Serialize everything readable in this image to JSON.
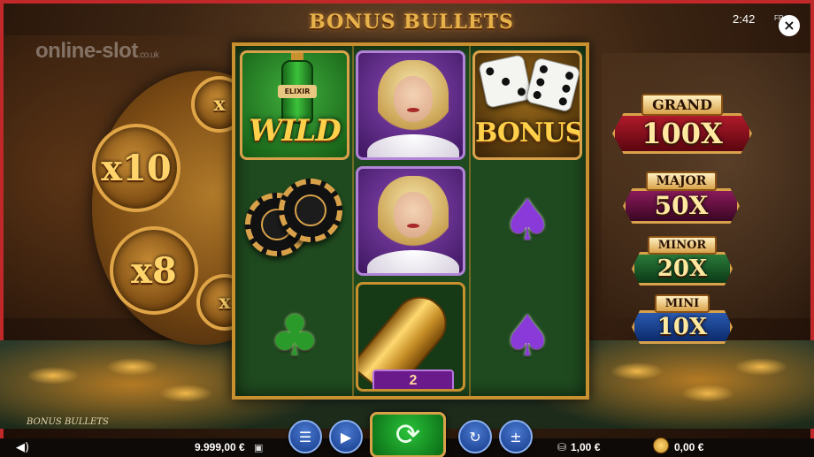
{
  "game": {
    "title": "BONUS BULLETS",
    "footer_name": "BONUS BULLETS"
  },
  "watermark": {
    "text": "online-slot",
    "suffix": ".co.uk"
  },
  "status": {
    "clock": "2:42",
    "fr_label": "FR"
  },
  "close_icon": "close-icon",
  "cylinder": {
    "multipliers": [
      "x10",
      "x8"
    ],
    "partial_labels": [
      "x",
      "x"
    ]
  },
  "reels": {
    "symbols": [
      [
        "wild-elixir",
        "blonde-lady",
        "bonus-dice"
      ],
      [
        "casino-chips",
        "blonde-lady",
        "spade"
      ],
      [
        "club",
        "golden-bullet",
        "spade"
      ]
    ],
    "wild_label": "WILD",
    "elixir_label": "ELIXIR",
    "bonus_label": "BONUS",
    "bullet_value": "2"
  },
  "jackpots": [
    {
      "name": "GRAND",
      "value": "100X"
    },
    {
      "name": "MAJOR",
      "value": "50X"
    },
    {
      "name": "MINOR",
      "value": "20X"
    },
    {
      "name": "MINI",
      "value": "10X"
    }
  ],
  "bottom_bar": {
    "balance": "9.999,00 €",
    "bet": "1,00 €",
    "win": "0,00 €"
  },
  "colors": {
    "frame_red": "#c0282a",
    "gold": "#d9a24a",
    "grand": "#8a1020",
    "major": "#6a1040",
    "minor": "#1a5a2a",
    "mini": "#12408a"
  }
}
